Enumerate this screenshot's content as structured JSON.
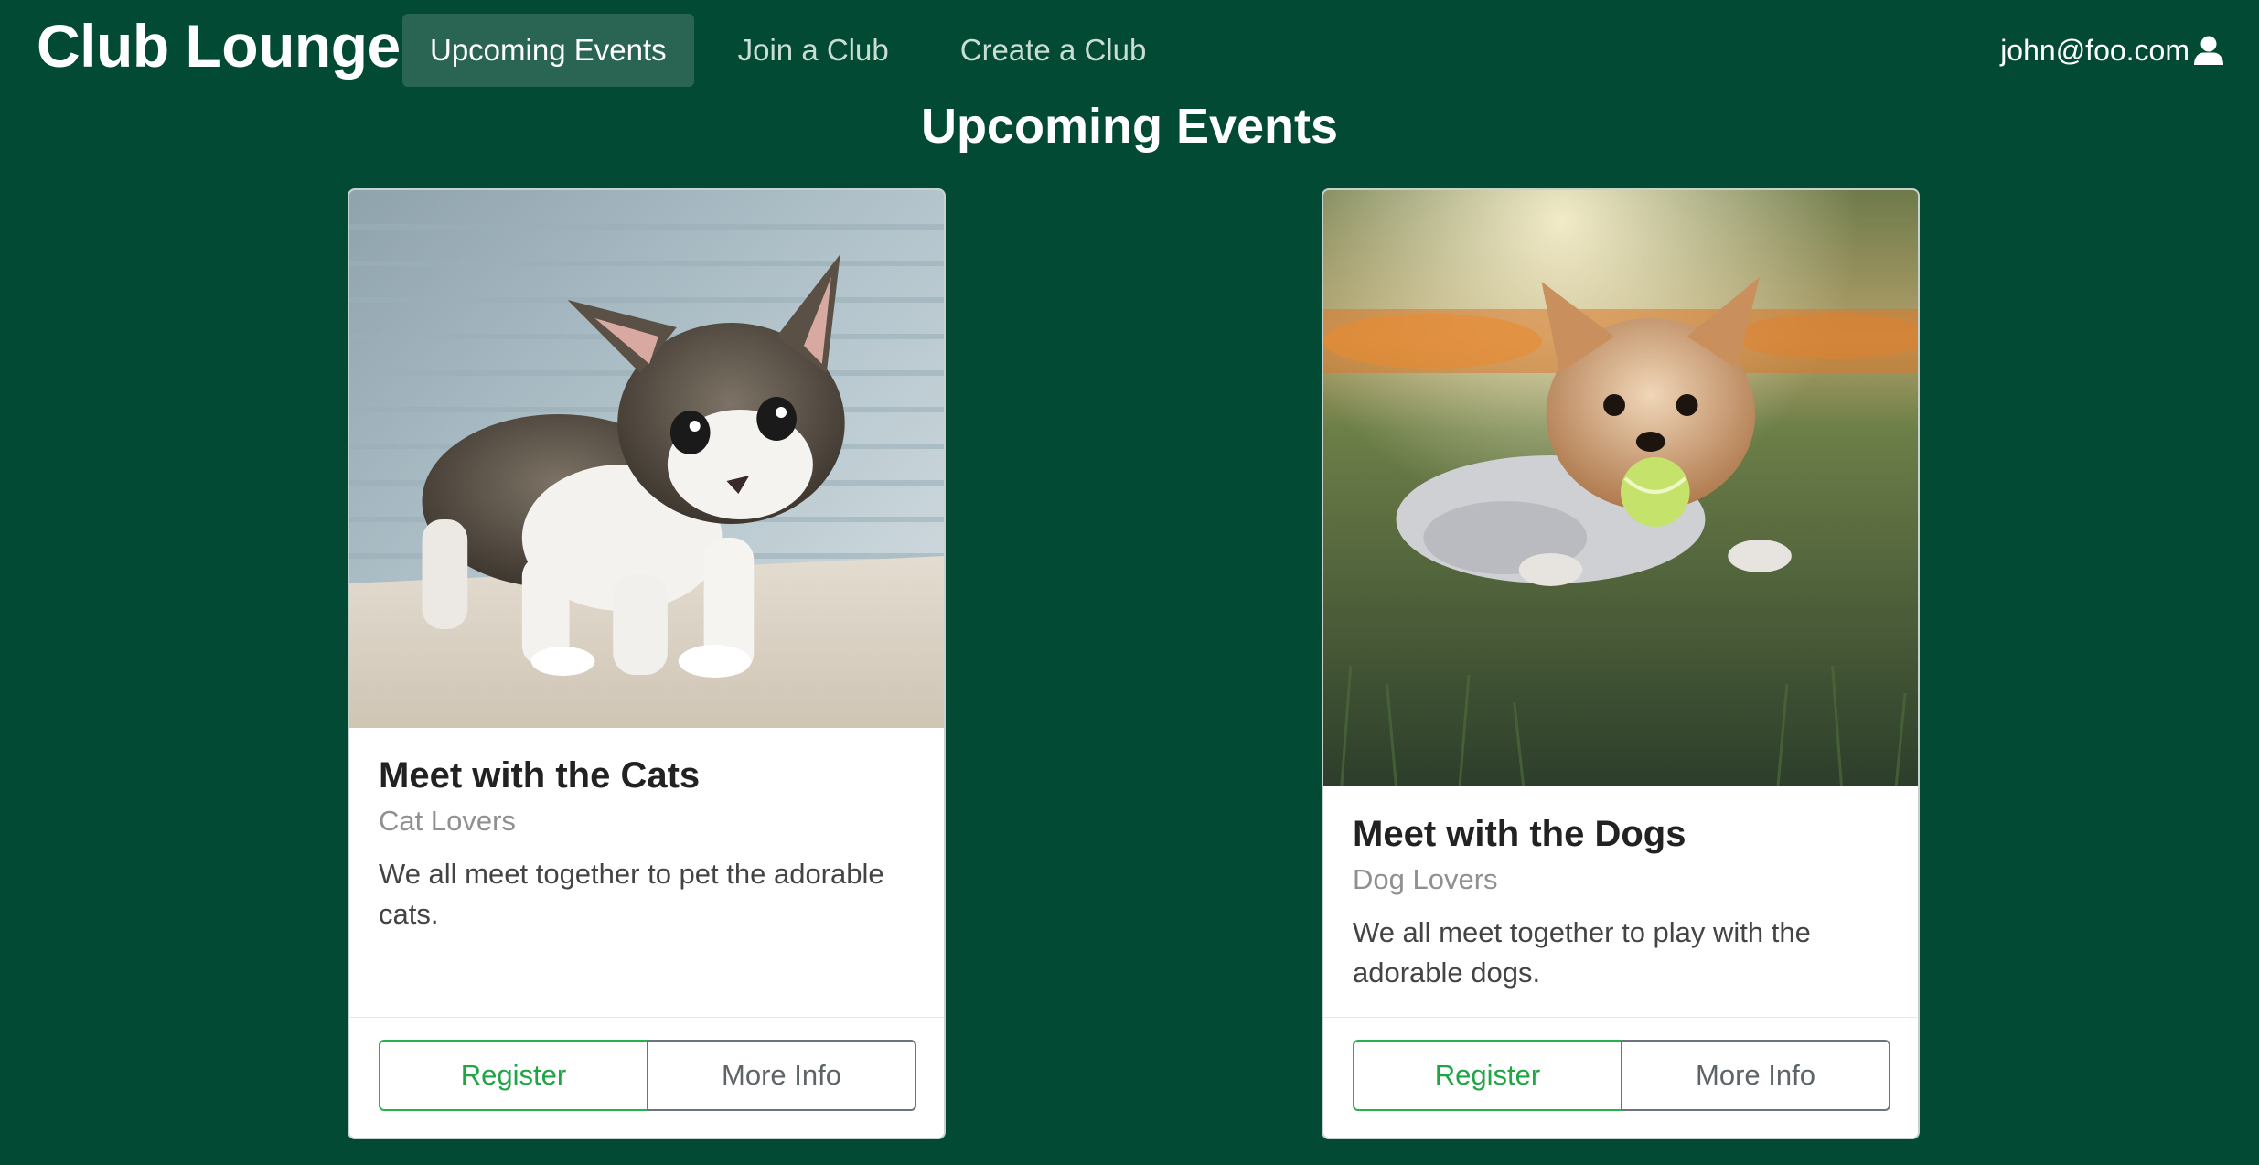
{
  "navbar": {
    "brand": "Club Lounge",
    "links": [
      {
        "label": "Upcoming Events",
        "active": true
      },
      {
        "label": "Join a Club",
        "active": false
      },
      {
        "label": "Create a Club",
        "active": false
      }
    ],
    "user_email": "john@foo.com",
    "user_icon": "user-icon"
  },
  "page": {
    "title": "Upcoming Events"
  },
  "events": [
    {
      "title": "Meet with the Cats",
      "club": "Cat Lovers",
      "description": "We all meet together to pet the adorable cats.",
      "image": "kitten-photo",
      "register_label": "Register",
      "more_info_label": "More Info"
    },
    {
      "title": "Meet with the Dogs",
      "club": "Dog Lovers",
      "description": "We all meet together to play with the adorable dogs.",
      "image": "dog-photo",
      "register_label": "Register",
      "more_info_label": "More Info"
    }
  ],
  "colors": {
    "background": "#024a33",
    "nav_active": "#2a6452",
    "register": "#1fa544",
    "more_info": "#6c757d"
  }
}
